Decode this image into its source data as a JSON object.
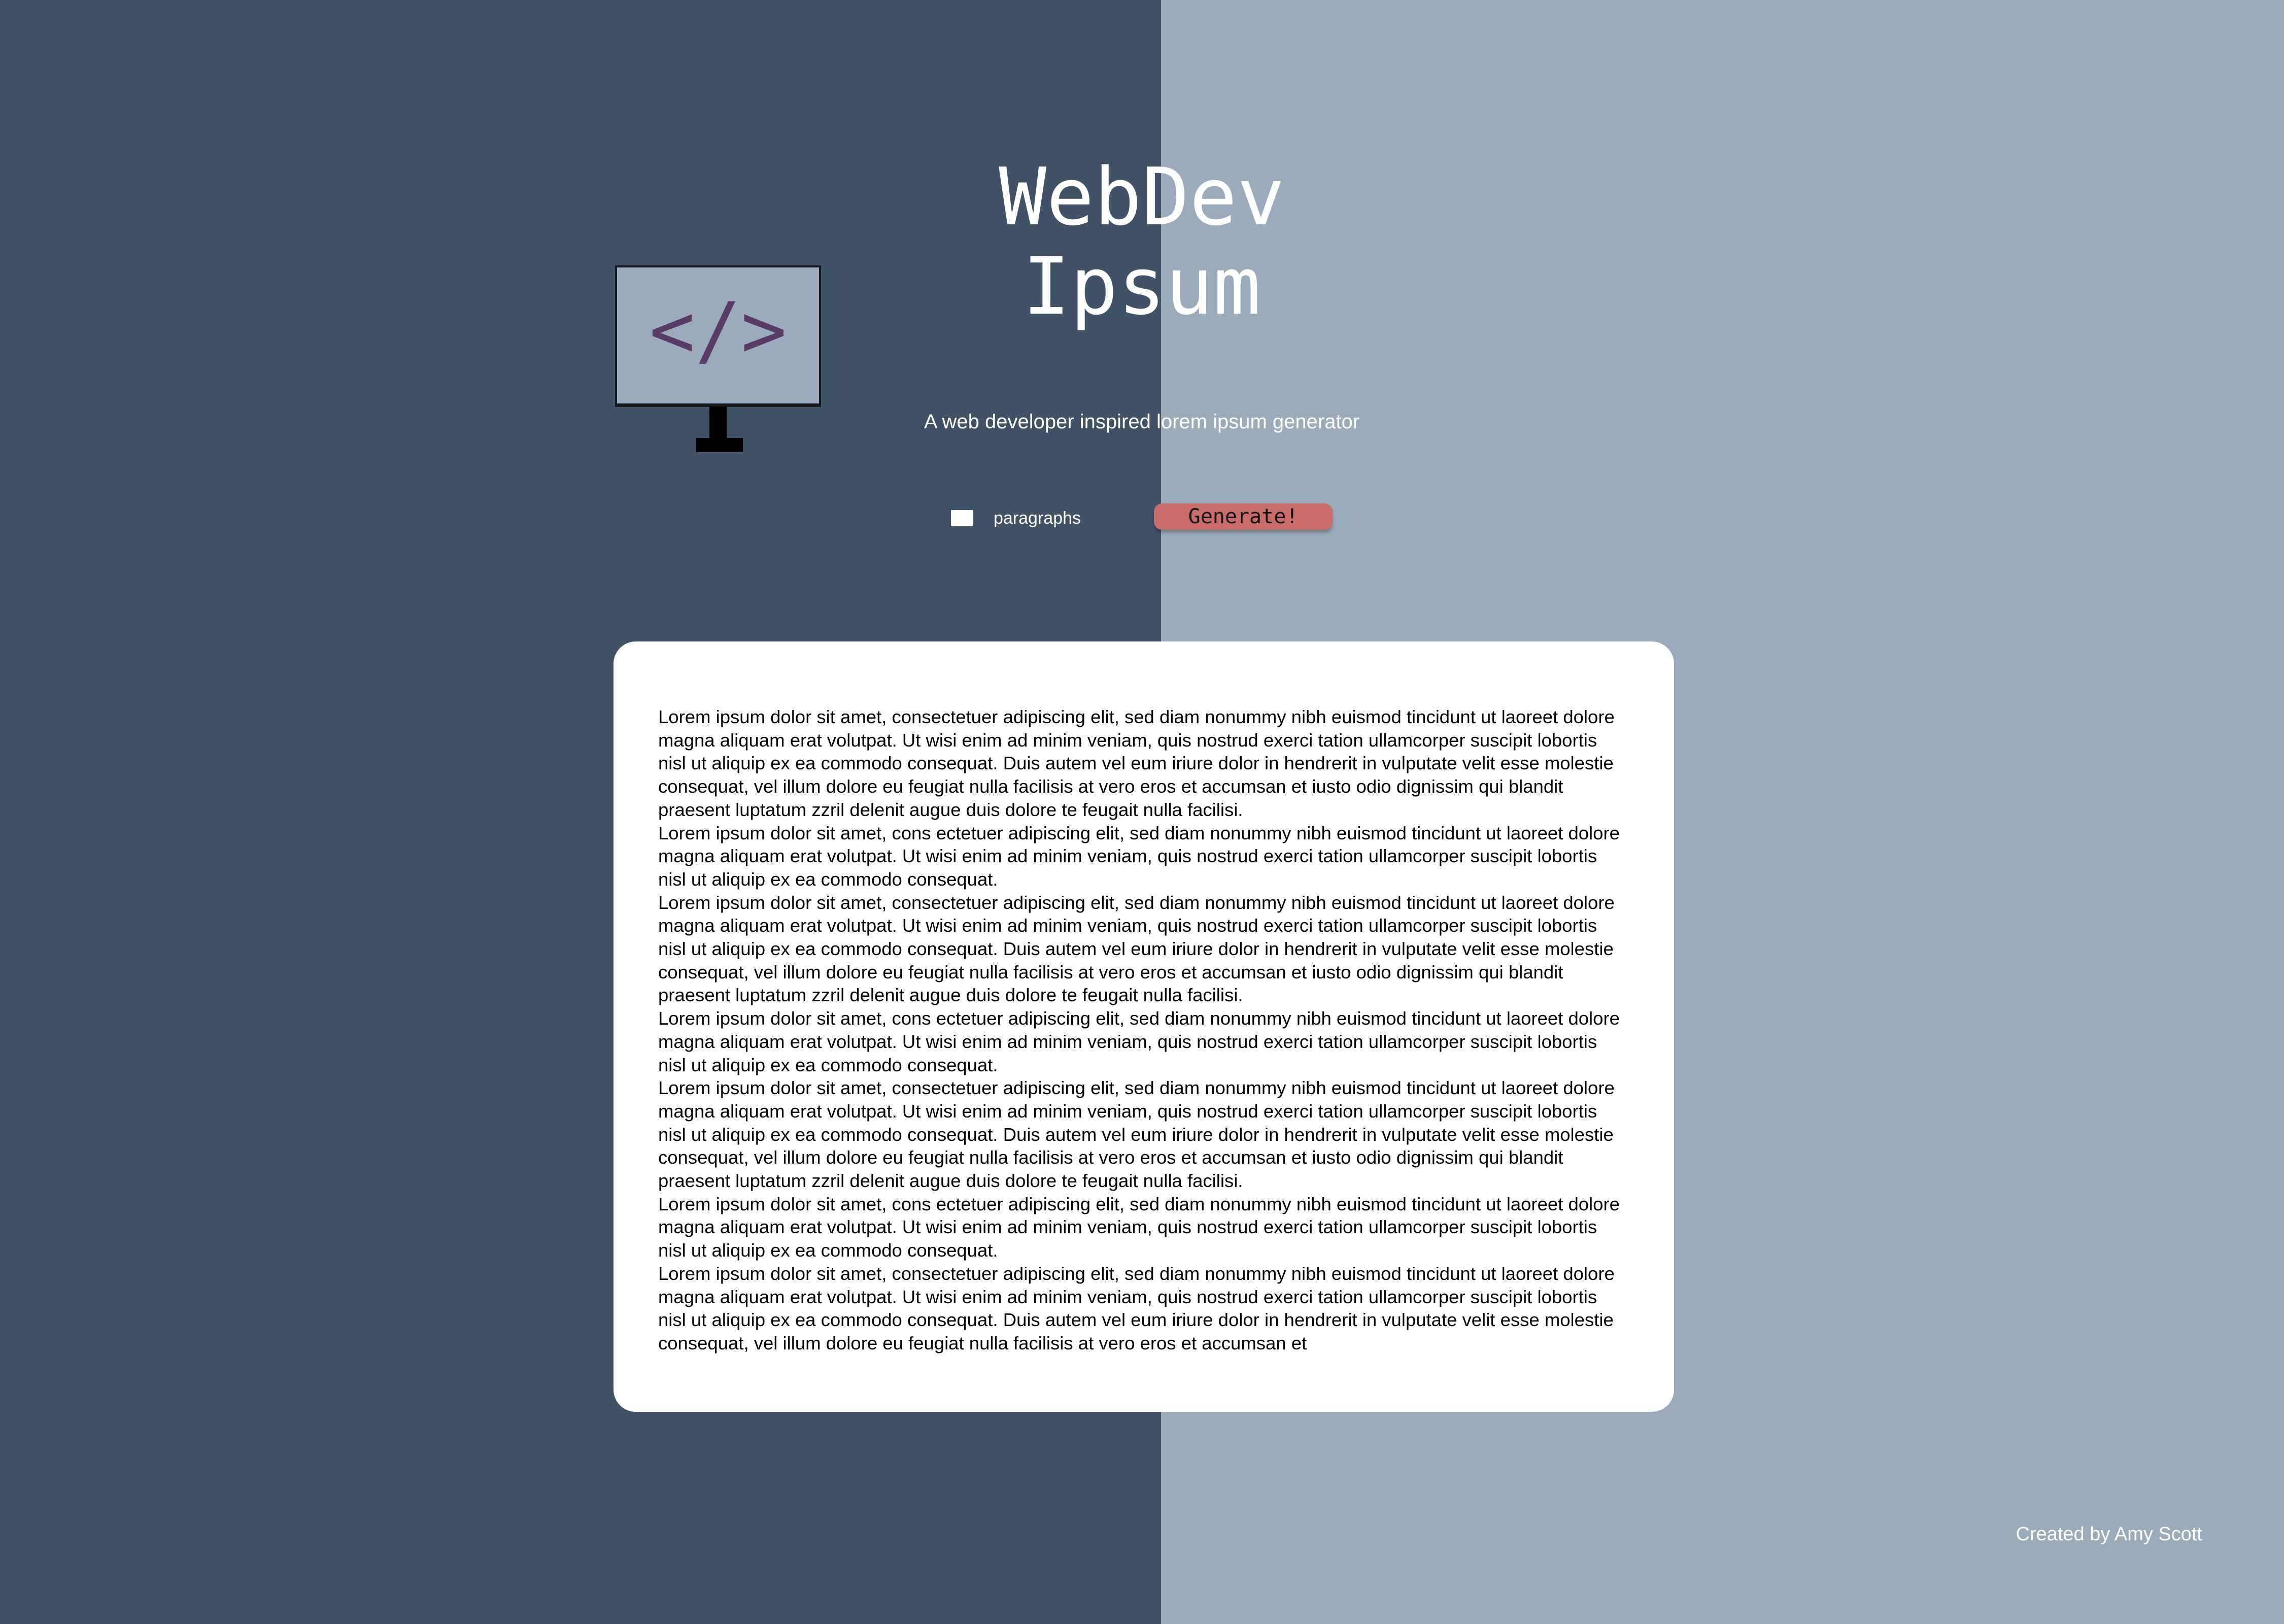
{
  "colors": {
    "left_background": "#405366",
    "right_background": "#9aabbb",
    "button": "#c96b6b",
    "code_symbol": "#5a3a66"
  },
  "logo": {
    "icon": "monitor-code-icon",
    "glyph": "</>"
  },
  "header": {
    "title": "WebDev\nIpsum",
    "subtitle": "A web developer inspired lorem ipsum generator"
  },
  "controls": {
    "count_value": "",
    "count_label": "paragraphs",
    "generate_label": "Generate!"
  },
  "output": {
    "paragraphs": [
      "Lorem ipsum dolor sit amet, consectetuer adipiscing elit, sed diam nonummy nibh euismod tincidunt ut laoreet dolore magna aliquam erat volutpat. Ut wisi enim ad minim veniam, quis nostrud exerci tation ullamcorper suscipit lobortis nisl ut aliquip ex ea commodo consequat. Duis autem vel eum iriure dolor in hendrerit in vulputate velit esse molestie consequat, vel illum dolore eu feugiat nulla facilisis at vero eros et accumsan et iusto odio dignissim qui blandit praesent luptatum zzril delenit augue duis dolore te feugait nulla facilisi.",
      "Lorem ipsum dolor sit amet, cons ectetuer adipiscing elit, sed diam nonummy nibh euismod tincidunt ut laoreet dolore magna aliquam erat volutpat. Ut wisi enim ad minim veniam, quis nostrud exerci tation ullamcorper suscipit lobortis nisl ut aliquip ex ea commodo consequat.",
      "Lorem ipsum dolor sit amet, consectetuer adipiscing elit, sed diam nonummy nibh euismod tincidunt ut laoreet dolore magna aliquam erat volutpat. Ut wisi enim ad minim veniam, quis nostrud exerci tation ullamcorper suscipit lobortis nisl ut aliquip ex ea commodo consequat. Duis autem vel eum iriure dolor in hendrerit in vulputate velit esse molestie consequat, vel illum dolore eu feugiat nulla facilisis at vero eros et accumsan et iusto odio dignissim qui blandit praesent luptatum zzril delenit augue duis dolore te feugait nulla facilisi.",
      "Lorem ipsum dolor sit amet, cons ectetuer adipiscing elit, sed diam nonummy nibh euismod tincidunt ut laoreet dolore magna aliquam erat volutpat. Ut wisi enim ad minim veniam, quis nostrud exerci tation ullamcorper suscipit lobortis nisl ut aliquip ex ea commodo consequat.",
      "Lorem ipsum dolor sit amet, consectetuer adipiscing elit, sed diam nonummy nibh euismod tincidunt ut laoreet dolore magna aliquam erat volutpat. Ut wisi enim ad minim veniam, quis nostrud exerci tation ullamcorper suscipit lobortis nisl ut aliquip ex ea commodo consequat. Duis autem vel eum iriure dolor in hendrerit in vulputate velit esse molestie consequat, vel illum dolore eu feugiat nulla facilisis at vero eros et accumsan et iusto odio dignissim qui blandit praesent luptatum zzril delenit augue duis dolore te feugait nulla facilisi.",
      "Lorem ipsum dolor sit amet, cons ectetuer adipiscing elit, sed diam nonummy nibh euismod tincidunt ut laoreet dolore magna aliquam erat volutpat. Ut wisi enim ad minim veniam, quis nostrud exerci tation ullamcorper suscipit lobortis nisl ut aliquip ex ea commodo consequat.",
      "Lorem ipsum dolor sit amet, consectetuer adipiscing elit, sed diam nonummy nibh euismod tincidunt ut laoreet dolore magna aliquam erat volutpat. Ut wisi enim ad minim veniam, quis nostrud exerci tation ullamcorper suscipit lobortis nisl ut aliquip ex ea commodo consequat. Duis autem vel eum iriure dolor in hendrerit in vulputate velit esse molestie consequat, vel illum dolore eu feugiat nulla facilisis at vero eros et accumsan et"
    ]
  },
  "footer": {
    "credit": "Created by Amy Scott"
  }
}
